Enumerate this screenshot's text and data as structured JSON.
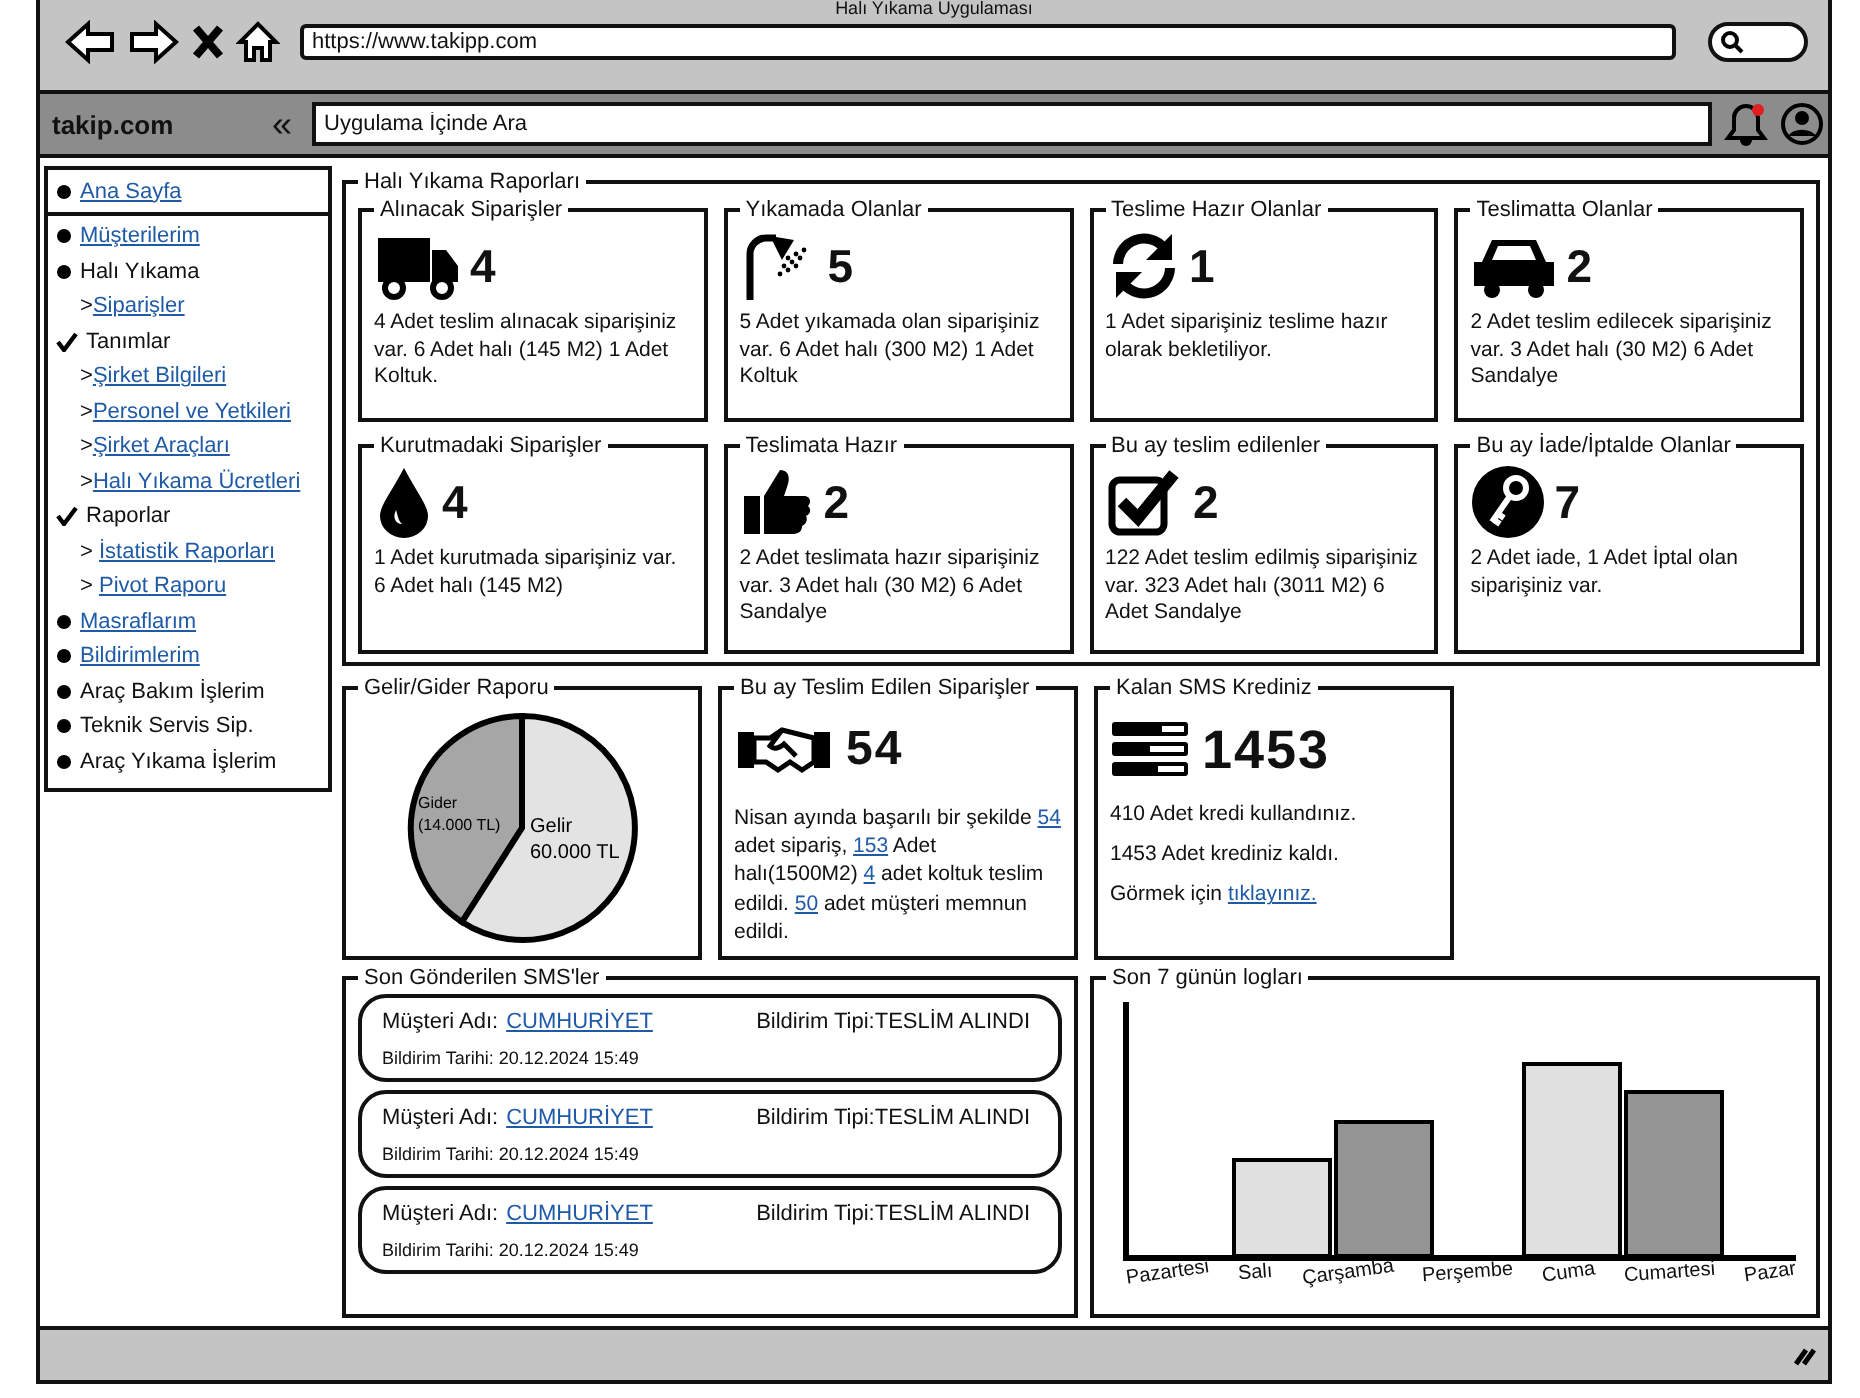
{
  "window": {
    "title": "Halı Yıkama Uygulaması"
  },
  "browser": {
    "url": "https://www.takipp.com"
  },
  "header": {
    "logo": "takip.com",
    "collapse": "«",
    "search": {
      "placeholder": "Uygulama İçinde Ara"
    },
    "notification": {
      "unread": true
    }
  },
  "sidebar": {
    "items": [
      {
        "label": "Ana Sayfa",
        "kind": "bullet",
        "link": true,
        "divider": true
      },
      {
        "label": "Müşterilerim",
        "kind": "bullet",
        "link": true
      },
      {
        "label": "Halı Yıkama",
        "kind": "bullet",
        "link": false,
        "children": [
          {
            "prefix": ">",
            "label": "Siparişler",
            "link": true
          }
        ]
      },
      {
        "label": "Tanımlar",
        "kind": "check",
        "link": false,
        "children": [
          {
            "prefix": ">",
            "label": "Şirket Bilgileri",
            "link": true
          },
          {
            "prefix": ">",
            "label": "Personel ve Yetkileri",
            "link": true
          },
          {
            "prefix": ">",
            "label": "Şirket Araçları",
            "link": true
          },
          {
            "prefix": ">",
            "label": "Halı Yıkama Ücretleri",
            "link": true
          }
        ]
      },
      {
        "label": "Raporlar",
        "kind": "check",
        "link": false,
        "children": [
          {
            "prefix": "> ",
            "label": "İstatistik Raporları",
            "link": true
          },
          {
            "prefix": "> ",
            "label": "Pivot Raporu",
            "link": true
          }
        ]
      },
      {
        "label": "Masraflarım",
        "kind": "bullet",
        "link": true
      },
      {
        "label": "Bildirimlerim",
        "kind": "bullet",
        "link": true
      },
      {
        "label": "Araç Bakım İşlerim",
        "kind": "bullet",
        "link": false
      },
      {
        "label": "Teknik Servis Sip.",
        "kind": "bullet",
        "link": false
      },
      {
        "label": "Araç Yıkama İşlerim",
        "kind": "bullet",
        "link": false
      }
    ]
  },
  "reports": {
    "title": "Halı Yıkama Raporları",
    "cards": [
      {
        "title": "Alınacak Siparişler",
        "count": "4",
        "text": "4 Adet teslim alınacak siparişiniz var. 6 Adet halı (145 M2) 1 Adet Koltuk."
      },
      {
        "title": "Yıkamada Olanlar",
        "count": "5",
        "text": "5 Adet yıkamada olan siparişiniz var. 6 Adet halı (300 M2) 1 Adet Koltuk"
      },
      {
        "title": "Teslime Hazır Olanlar",
        "count": "1",
        "text": "1 Adet siparişiniz teslime hazır olarak bekletiliyor."
      },
      {
        "title": "Teslimatta Olanlar",
        "count": "2",
        "text": "2 Adet teslim edilecek siparişiniz var. 3 Adet halı (30 M2) 6 Adet Sandalye"
      },
      {
        "title": "Kurutmadaki Siparişler",
        "count": "4",
        "text": "1 Adet kurutmada siparişiniz var. 6 Adet halı (145 M2)"
      },
      {
        "title": "Teslimata Hazır",
        "count": "2",
        "text": "2 Adet teslimata hazır siparişiniz var. 3 Adet halı (30 M2) 6 Adet Sandalye"
      },
      {
        "title": "Bu ay teslim edilenler",
        "count": "2",
        "text": "122 Adet teslim edilmiş siparişiniz var. 323 Adet halı (3011 M2) 6 Adet Sandalye"
      },
      {
        "title": "Bu ay İade/İptalde Olanlar",
        "count": "7",
        "text": "2 Adet iade, 1 Adet İptal olan siparişiniz var."
      }
    ]
  },
  "income": {
    "title": "Gelir/Gider Raporu",
    "slices": [
      {
        "label": "Gider",
        "amount": "(14.000 TL)",
        "color": "#a6a6a6"
      },
      {
        "label": "Gelir",
        "amount": "60.000 TL",
        "color": "#e3e3e3"
      }
    ]
  },
  "delivered": {
    "title": "Bu ay Teslim Edilen Siparişler",
    "count": "54",
    "paragraph": [
      {
        "kind": "text",
        "text": "Nisan ayında başarılı bir şekilde "
      },
      {
        "kind": "link",
        "text": "54"
      },
      {
        "kind": "text",
        "text": " adet sipariş, "
      },
      {
        "kind": "link",
        "text": "153"
      },
      {
        "kind": "text",
        "text": " Adet halı(1500M2) "
      },
      {
        "kind": "link",
        "text": "4"
      },
      {
        "kind": "text",
        "text": " adet koltuk teslim edildi. "
      },
      {
        "kind": "link",
        "text": "50"
      },
      {
        "kind": "text",
        "text": " adet müşteri memnun edildi."
      }
    ]
  },
  "sms_credit": {
    "title": "Kalan SMS Krediniz",
    "count": "1453",
    "lines": [
      "410 Adet kredi kullandınız.",
      "1453 Adet krediniz kaldı."
    ],
    "cta": {
      "text": "Görmek için",
      "link": "tıklayınız."
    }
  },
  "sms_list": {
    "title": "Son Gönderilen SMS'ler",
    "items": [
      {
        "customer_label": "Müşteri Adı:",
        "customer": "CUMHURİYET",
        "type": "Bildirim Tipi:TESLİM ALINDI",
        "date": "Bildirim Tarihi: 20.12.2024 15:49"
      },
      {
        "customer_label": "Müşteri Adı:",
        "customer": "CUMHURİYET",
        "type": "Bildirim Tipi:TESLİM ALINDI",
        "date": "Bildirim Tarihi: 20.12.2024 15:49"
      },
      {
        "customer_label": "Müşteri Adı:",
        "customer": "CUMHURİYET",
        "type": "Bildirim Tipi:TESLİM ALINDI",
        "date": "Bildirim Tarihi: 20.12.2024 15:49"
      }
    ]
  },
  "logs": {
    "title": "Son 7 günün logları",
    "days": [
      "Pazartesi",
      "Salı",
      "Çarşamba",
      "Perşembe",
      "Cuma",
      "Cumartesi",
      "Pazar"
    ]
  }
}
